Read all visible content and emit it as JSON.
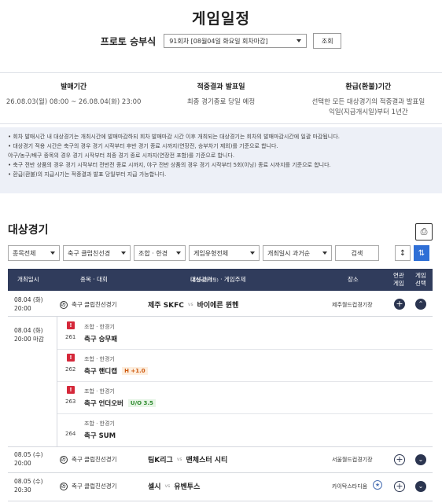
{
  "page": {
    "title": "게임일정"
  },
  "selector": {
    "label": "프로토 승부식",
    "value": "91회차 [08월04일 화요일 회차마감]",
    "button": "조회"
  },
  "info": [
    {
      "heading": "발매기간",
      "lines": [
        "26.08.03(월) 08:00 ~ 26.08.04(화) 23:00"
      ]
    },
    {
      "heading": "적중결과 발표일",
      "lines": [
        "최종 경기종료 당일 예정"
      ]
    },
    {
      "heading": "환급(환불)기간",
      "lines": [
        "선택한 모든 대상경기의 적중결과 발표일",
        "익일(지급개시일)부터 1년간"
      ]
    }
  ],
  "notes": [
    "• 회차 발매시간 내 대상경기는 개최시간에 발매마감하되 회차 발매마감 시간 이후 개최되는 대상경기는 회차의 발매마감시간에 일괄 마감됩니다.",
    "• 대상경기 적용 시간은 축구의 경우 경기 시작부터 후반 경기 종료 시까지(연장전, 승부차기 제외)를 기준으로 합니다.",
    "  야구/농구/배구 종목의 경우 경기 시작부터 최종 경기 종료 시까지(연장전 포함)를 기준으로 합니다.",
    "• 축구 전반 상품의 경우 경기 시작부터 전반전 종료 시까지, 야구 전반 상품의 경우 경기 시작부터 5회(이닝) 종료 시까지를 기준으로 합니다.",
    "• 환급(환불)의 지급시기는 적중결과 발표 당일부터 지급 가능합니다."
  ],
  "section": {
    "title": "대상경기"
  },
  "filters": {
    "sport": "종목전체",
    "league": "축구 클럽친선경",
    "combo": "조합 · 한경",
    "type": "게임유형전체",
    "order": "개최일시 과거순",
    "search": "검색"
  },
  "table_header": {
    "date": "개최일시",
    "sport": "종목 · 대회",
    "match": "대상경기",
    "match_sub": "(홈팀vs원정팀)",
    "match_tail": "· 게임주제",
    "venue": "장소",
    "related": [
      "연관",
      "게임"
    ],
    "select": [
      "게임",
      "선택"
    ]
  },
  "matches": [
    {
      "date": "08.04 (화)",
      "time": "20:00",
      "competition": "축구 클럽친선경기",
      "home": "제주 SKFC",
      "vs": "vs",
      "away": "바이에른 뮌헨",
      "venue": "제주월드컵경기장"
    },
    {
      "date": "08.05 (수)",
      "time": "20:00",
      "competition": "축구 클럽친선경기",
      "home": "팀K리그",
      "vs": "vs",
      "away": "맨체스터 시티",
      "venue": "서울월드컵경기장"
    },
    {
      "date": "08.05 (수)",
      "time": "20:30",
      "competition": "축구 클럽친선경기",
      "home": "셀시",
      "vs": "vs",
      "away": "유벤투스",
      "venue": "카이탁스타디움"
    }
  ],
  "sub_header": {
    "date": "08.04 (화)",
    "time": "20:00 마감"
  },
  "sub_games": [
    {
      "num": "261",
      "type": "조합 · 한경기",
      "name": "축구 승무패",
      "tag": ""
    },
    {
      "num": "262",
      "type": "조합 · 한경기",
      "name": "축구 핸디캡",
      "tag": "H +1.0"
    },
    {
      "num": "263",
      "type": "조합 · 한경기",
      "name": "축구 언더오버",
      "tag": "U/O 3.5"
    },
    {
      "num": "264",
      "type": "조합 · 한경기",
      "name": "축구 SUM",
      "tag": ""
    }
  ],
  "icons": {
    "print": "printer-icon",
    "warning": "alert-icon",
    "ball": "soccer-ball-icon",
    "plus": "plus-icon",
    "chevron": "chevron-icon",
    "star": "favorite-icon"
  },
  "colors": {
    "header_bg": "#303c5c",
    "notes_bg": "#edf0f7",
    "accent": "#2f6fd6",
    "warning": "#d5283a"
  }
}
